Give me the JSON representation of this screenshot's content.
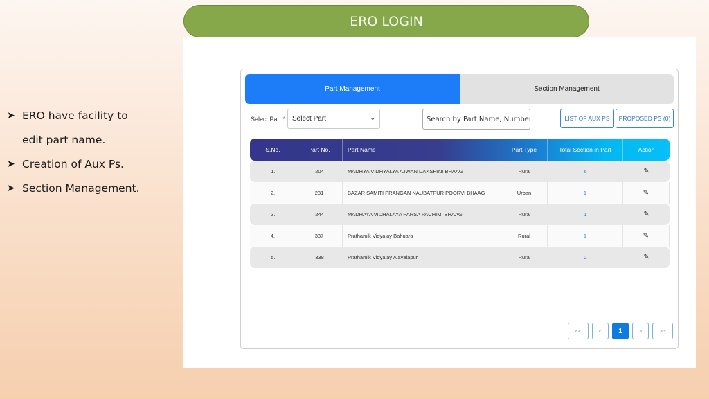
{
  "slide": {
    "title": "ERO LOGIN",
    "bullets": [
      {
        "text": "ERO have facility to",
        "continuation": "edit part name."
      },
      {
        "text": "Creation of Aux Ps."
      },
      {
        "text": "Section Management."
      }
    ],
    "bullet_icon": "arrowhead-bullet-icon"
  },
  "app": {
    "tabs": [
      {
        "label": "Part Management",
        "active": true
      },
      {
        "label": "Section Management",
        "active": false
      }
    ],
    "filter": {
      "label": "Select Part",
      "required_mark": "*",
      "select_value": "Select Part"
    },
    "search": {
      "placeholder": "Search by Part Name, Number, Type",
      "value": ""
    },
    "buttons": {
      "list_aux": "LIST OF AUX PS",
      "proposed": "PROPOSED PS (0)"
    },
    "table": {
      "headers": [
        "S.No.",
        "Part No.",
        "Part Name",
        "Part Type",
        "Total Section in Part",
        "Action"
      ],
      "rows": [
        {
          "sno": "1.",
          "part_no": "204",
          "part_name": "MADHYA VIDHYALYA AJWAN DAKSHINI BHAAG",
          "type": "Rural",
          "sections": "6",
          "action": "edit"
        },
        {
          "sno": "2.",
          "part_no": "231",
          "part_name": "BAZAR SAMITI PRANGAN NAUBATPUR POORVI BHAAG",
          "type": "Urban",
          "sections": "1",
          "action": "edit"
        },
        {
          "sno": "3.",
          "part_no": "244",
          "part_name": "MADHAYA VIDHALAYA PARSA PACHIMI BHAAG",
          "type": "Rural",
          "sections": "1",
          "action": "edit"
        },
        {
          "sno": "4.",
          "part_no": "337",
          "part_name": "Prathamik Vidyalay Bahuara",
          "type": "Rural",
          "sections": "1",
          "action": "edit"
        },
        {
          "sno": "5.",
          "part_no": "338",
          "part_name": "Prathamik Vidyalay Alavalapur",
          "type": "Rural",
          "sections": "2",
          "action": "edit"
        }
      ]
    },
    "pagination": {
      "first": "<<",
      "prev": "<",
      "current": "1",
      "next": ">",
      "last": ">>"
    },
    "colors": {
      "title_green": "#86a84a",
      "tab_active": "#1d7cf8",
      "header_start": "#33368a",
      "header_end": "#06c0f7",
      "link_blue": "#3a7bd5",
      "page_active": "#0f7be0"
    }
  }
}
